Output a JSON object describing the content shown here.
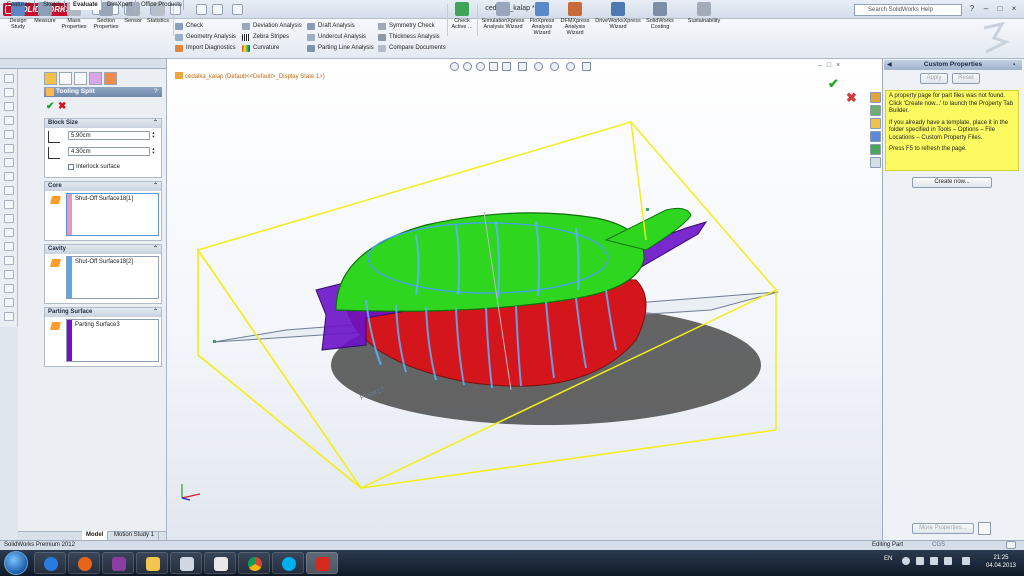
{
  "app": {
    "logo": "SOLIDWORKS",
    "document_title": "cedalka_kalap *",
    "search_placeholder": "Search SolidWorks Help"
  },
  "ribbon": {
    "big_buttons": [
      {
        "label": "Design Study",
        "icon": "design-study-icon"
      },
      {
        "label": "Measure",
        "icon": "measure-icon"
      },
      {
        "label": "Mass Properties",
        "icon": "mass-properties-icon"
      },
      {
        "label": "Section Properties",
        "icon": "section-properties-icon"
      },
      {
        "label": "Sensor",
        "icon": "sensor-icon"
      },
      {
        "label": "Statistics",
        "icon": "statistics-icon"
      }
    ],
    "col1": [
      "Check",
      "Geometry Analysis",
      "Import Diagnostics"
    ],
    "col2": [
      "Deviation Analysis",
      "Zebra Stripes",
      "Curvature"
    ],
    "col3": [
      "Draft Analysis",
      "Undercut Analysis",
      "Parting Line Analysis"
    ],
    "col4": [
      "Symmetry Check",
      "Thickness Analysis",
      "Compare Documents"
    ],
    "check_active": "Check Active ...",
    "right_buttons": [
      "SimulationXpress Analysis Wizard",
      "FloXpress Analysis Wizard",
      "DFMXpress Analysis Wizard",
      "DriveWorksXpress Wizard",
      "SolidWorks Costing",
      "Sustainability"
    ]
  },
  "tabs": [
    "Features",
    "Sketch",
    "Evaluate",
    "DimXpert",
    "Office Products"
  ],
  "active_tab": "Evaluate",
  "property_manager": {
    "title": "Tooling Split",
    "help": "?",
    "block_size": {
      "header": "Block Size",
      "depth1": "5.90cm",
      "depth2": "4.30cm",
      "interlock": "Interlock surface"
    },
    "core": {
      "header": "Core",
      "item": "Shut-Off Surface18[1]"
    },
    "cavity": {
      "header": "Cavity",
      "item": "Shut-Off Surface18[2]"
    },
    "parting": {
      "header": "Parting Surface",
      "item": "Parting Surface3"
    }
  },
  "bottom_tabs": [
    "Model",
    "Motion Study 1"
  ],
  "graphics": {
    "breadcrumb": "cedalka_kalap  (Default<<Default>_Display State 1>)",
    "plane_label": "Plane17"
  },
  "task_pane": {
    "header": "Custom Properties",
    "apply": "Apply",
    "reset": "Reset",
    "note_p1": "A property page for part files was not found. Click 'Create now...' to launch the Property Tab Builder.",
    "note_p2": "If you already have a template, place it in the folder specified in Tools – Options – File Locations – Custom Property Files.",
    "note_p3": "Press F5 to refresh the page.",
    "create_now": "Create now...",
    "more_properties": "More Properties..."
  },
  "status": {
    "left": "SolidWorks Premium 2012",
    "mode": "Editing Part",
    "units": "CGS"
  },
  "taskbar": {
    "lang": "EN",
    "time": "21:25",
    "date": "04.04.2013"
  },
  "colors": {
    "cavity_red": "#d4161c",
    "core_green": "#2ed61f",
    "parting_purple": "#6a12c8",
    "bbox_yellow": "#f2ee1a",
    "note_yellow": "#fcfa61"
  }
}
